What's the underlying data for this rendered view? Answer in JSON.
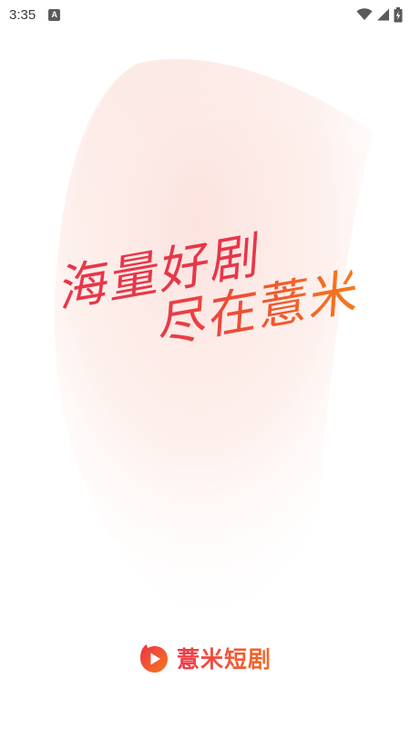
{
  "status_bar": {
    "time": "3:35",
    "notification_badge": "A",
    "icons": [
      "wifi-icon",
      "cellular-signal-icon",
      "battery-charging-icon"
    ]
  },
  "slogan": {
    "line1": "海量好剧",
    "line2": "尽在薏米"
  },
  "brand": {
    "name": "薏米短剧",
    "logo_icon": "play-logo-icon"
  },
  "colors": {
    "primary_red": "#e8364a",
    "primary_orange": "#f57a1c",
    "background": "#ffffff",
    "deco_pink": "#fde7e3"
  }
}
